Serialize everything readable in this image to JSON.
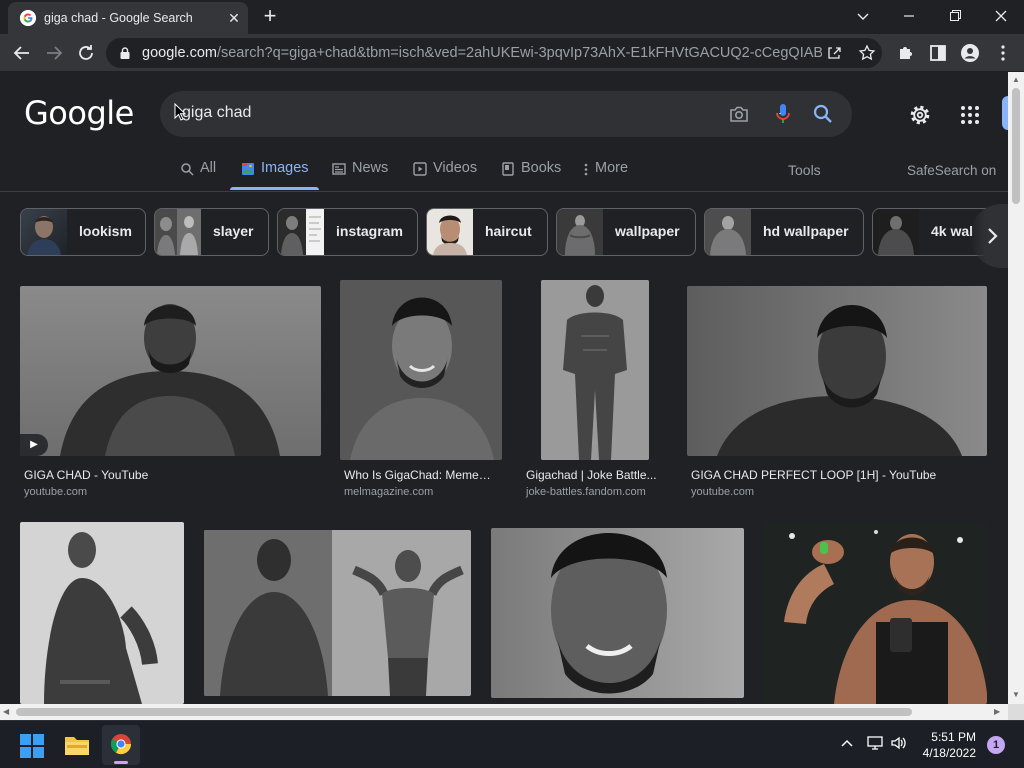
{
  "browser": {
    "tab_title": "giga chad - Google Search",
    "tab_close": "✕",
    "new_tab": "+",
    "url_host": "google.com",
    "url_path": "/search?q=giga+chad&tbm=isch&ved=2ahUKEwi-3pqvIp73AhX-E1kFHVtGACUQ2-cCegQIABA..."
  },
  "google": {
    "logo": "Google",
    "query": "giga chad",
    "tabs": [
      {
        "label": "All",
        "icon": "search-icon"
      },
      {
        "label": "Images",
        "icon": "image-icon"
      },
      {
        "label": "News",
        "icon": "news-icon"
      },
      {
        "label": "Videos",
        "icon": "play-icon"
      },
      {
        "label": "Books",
        "icon": "book-icon"
      },
      {
        "label": "More",
        "icon": "more-vert-icon"
      }
    ],
    "tools": "Tools",
    "safesearch": "SafeSearch on",
    "chips": [
      "lookism",
      "slayer",
      "instagram",
      "haircut",
      "wallpaper",
      "hd wallpaper",
      "4k wal"
    ],
    "results": [
      {
        "caption": "GIGA CHAD - YouTube",
        "source": "youtube.com"
      },
      {
        "caption": "Who Is GigaChad: Meme, ...",
        "source": "melmagazine.com"
      },
      {
        "caption": "Gigachad | Joke Battle...",
        "source": "joke-battles.fandom.com"
      },
      {
        "caption": "GIGA CHAD PERFECT LOOP [1H] - YouTube",
        "source": "youtube.com"
      }
    ],
    "play_badge": "▶"
  },
  "taskbar": {
    "time": "5:51 PM",
    "date": "4/18/2022",
    "notification_count": "1"
  }
}
